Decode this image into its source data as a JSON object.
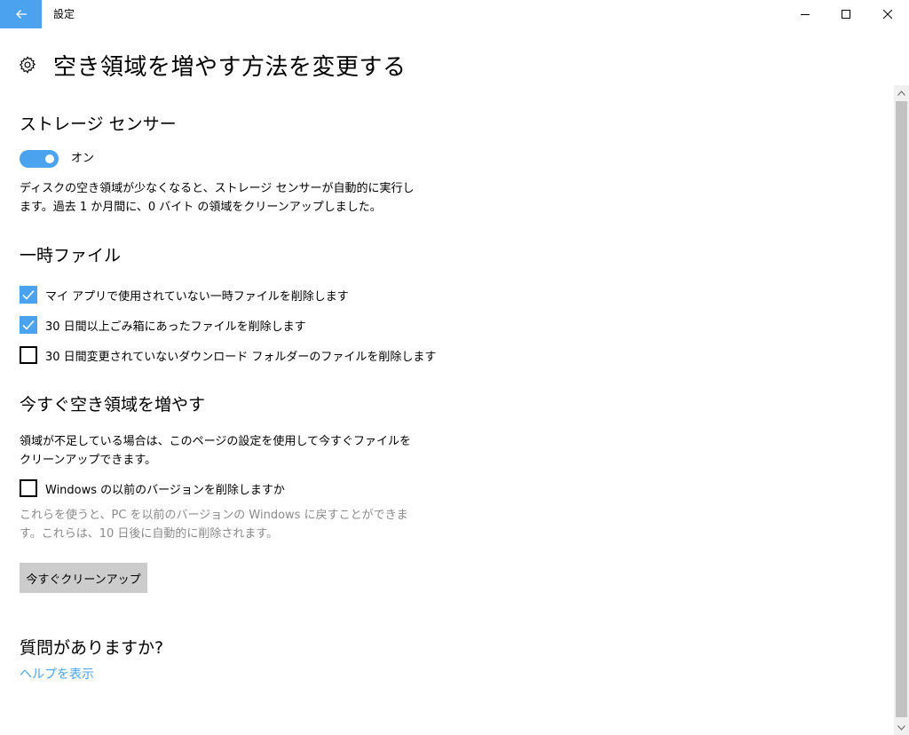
{
  "window": {
    "title": "設定"
  },
  "header": {
    "title": "空き領域を増やす方法を変更する",
    "icon": "gear-icon"
  },
  "storage_sense": {
    "title": "ストレージ センサー",
    "toggle_state": "on",
    "toggle_label": "オン",
    "description": "ディスクの空き領域が少なくなると、ストレージ センサーが自動的に実行します。過去 1 か月間に、0 バイト の領域をクリーンアップしました。"
  },
  "temp_files": {
    "title": "一時ファイル",
    "options": [
      {
        "label": "マイ アプリで使用されていない一時ファイルを削除します",
        "checked": true
      },
      {
        "label": "30 日間以上ごみ箱にあったファイルを削除します",
        "checked": true
      },
      {
        "label": "30 日間変更されていないダウンロード フォルダーのファイルを削除します",
        "checked": false
      }
    ]
  },
  "free_now": {
    "title": "今すぐ空き領域を増やす",
    "description": "領域が不足している場合は、このページの設定を使用して今すぐファイルをクリーンアップできます。",
    "option": {
      "label": "Windows の以前のバージョンを削除しますか",
      "checked": false
    },
    "note": "これらを使うと、PC を以前のバージョンの Windows に戻すことができます。これらは、10 日後に自動的に削除されます。",
    "button_label": "今すぐクリーンアップ"
  },
  "help": {
    "title": "質問がありますか?",
    "link_label": "ヘルプを表示"
  },
  "colors": {
    "accent": "#4ba3ef",
    "button_bg": "#cccccc",
    "muted_text": "#8a8a8a"
  }
}
